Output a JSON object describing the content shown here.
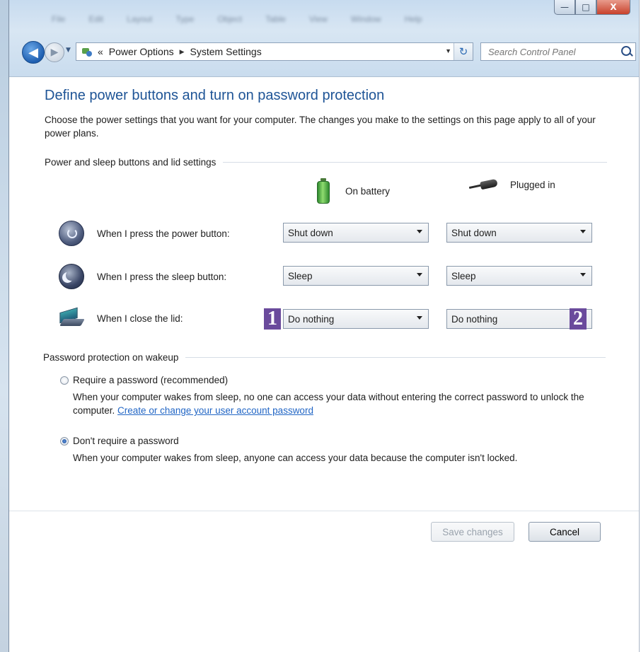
{
  "window": {
    "controls": {
      "minimize": "—",
      "maximize": "□",
      "close": "X"
    }
  },
  "menubar": [
    "File",
    "Edit",
    "Layout",
    "Type",
    "Object",
    "Table",
    "View",
    "Window",
    "Help"
  ],
  "nav": {
    "back_glyph": "◀",
    "forward_glyph": "▶",
    "breadcrumb": [
      "Power Options",
      "System Settings"
    ],
    "crumb_prefix": "«",
    "crumb_separator": "▶",
    "dropdown_glyph": "▼",
    "refresh_glyph": "↻",
    "search_placeholder": "Search Control Panel"
  },
  "page": {
    "title": "Define power buttons and turn on password protection",
    "intro": "Choose the power settings that you want for your computer. The changes you make to the settings on this page apply to all of your power plans."
  },
  "buttons_section": {
    "heading": "Power and sleep buttons and lid settings",
    "col_battery": "On battery",
    "col_plugged": "Plugged in",
    "rows": [
      {
        "label": "When I press the power button:",
        "battery": "Shut down",
        "plugged": "Shut down"
      },
      {
        "label": "When I press the sleep button:",
        "battery": "Sleep",
        "plugged": "Sleep"
      },
      {
        "label": "When I close the lid:",
        "battery": "Do nothing",
        "plugged": "Do nothing"
      }
    ],
    "markers": [
      "1",
      "2"
    ]
  },
  "password_section": {
    "heading": "Password protection on wakeup",
    "option_require": {
      "label": "Require a password (recommended)",
      "desc": "When your computer wakes from sleep, no one can access your data without entering the correct password to unlock the computer.",
      "link": "Create or change your user account password",
      "checked": false
    },
    "option_none": {
      "label": "Don't require a password",
      "desc": "When your computer wakes from sleep, anyone can access your data because the computer isn't locked.",
      "checked": true
    }
  },
  "footer": {
    "save_label": "Save changes",
    "cancel_label": "Cancel"
  },
  "colors": {
    "title_blue": "#1e5496",
    "link_blue": "#2266c5",
    "marker_purple": "#6a4a9c"
  }
}
